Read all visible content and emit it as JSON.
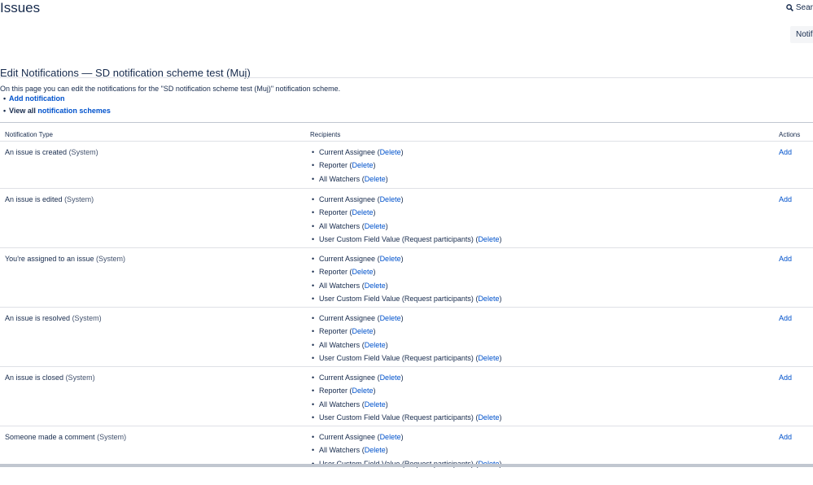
{
  "header": {
    "title": "Issues",
    "search_label": "Sear",
    "notifications_button": "Notifi"
  },
  "scheme": {
    "title": "Edit Notifications — SD notification scheme test (Muj)",
    "intro": "On this page you can edit the notifications for the \"SD notification scheme test (Muj)\" notification scheme.",
    "add_notification": "Add notification",
    "view_all_prefix": "View all",
    "view_all_link": "notification schemes"
  },
  "table": {
    "headers": {
      "type": "Notification Type",
      "recipients": "Recipients",
      "actions": "Actions"
    },
    "rows": [
      {
        "event": "An issue is created",
        "tag": "(System)",
        "action": "Add",
        "recipients": [
          {
            "name": "Current Assignee",
            "delete": "Delete"
          },
          {
            "name": "Reporter",
            "delete": "Delete"
          },
          {
            "name": "All Watchers",
            "delete": "Delete"
          }
        ]
      },
      {
        "event": "An issue is edited",
        "tag": "(System)",
        "action": "Add",
        "recipients": [
          {
            "name": "Current Assignee",
            "delete": "Delete"
          },
          {
            "name": "Reporter",
            "delete": "Delete"
          },
          {
            "name": "All Watchers",
            "delete": "Delete"
          },
          {
            "name": "User Custom Field Value (Request participants)",
            "delete": "Delete"
          }
        ]
      },
      {
        "event": "You're assigned to an issue",
        "tag": "(System)",
        "action": "Add",
        "recipients": [
          {
            "name": "Current Assignee",
            "delete": "Delete"
          },
          {
            "name": "Reporter",
            "delete": "Delete"
          },
          {
            "name": "All Watchers",
            "delete": "Delete"
          },
          {
            "name": "User Custom Field Value (Request participants)",
            "delete": "Delete"
          }
        ]
      },
      {
        "event": "An issue is resolved",
        "tag": "(System)",
        "action": "Add",
        "recipients": [
          {
            "name": "Current Assignee",
            "delete": "Delete"
          },
          {
            "name": "Reporter",
            "delete": "Delete"
          },
          {
            "name": "All Watchers",
            "delete": "Delete"
          },
          {
            "name": "User Custom Field Value (Request participants)",
            "delete": "Delete"
          }
        ]
      },
      {
        "event": "An issue is closed",
        "tag": "(System)",
        "action": "Add",
        "recipients": [
          {
            "name": "Current Assignee",
            "delete": "Delete"
          },
          {
            "name": "Reporter",
            "delete": "Delete"
          },
          {
            "name": "All Watchers",
            "delete": "Delete"
          },
          {
            "name": "User Custom Field Value (Request participants)",
            "delete": "Delete"
          }
        ]
      },
      {
        "event": "Someone made a comment",
        "tag": "(System)",
        "action": "Add",
        "recipients": [
          {
            "name": "Current Assignee",
            "delete": "Delete"
          },
          {
            "name": "All Watchers",
            "delete": "Delete"
          },
          {
            "name": "User Custom Field Value (Request participants)",
            "delete": "Delete"
          }
        ]
      }
    ]
  }
}
